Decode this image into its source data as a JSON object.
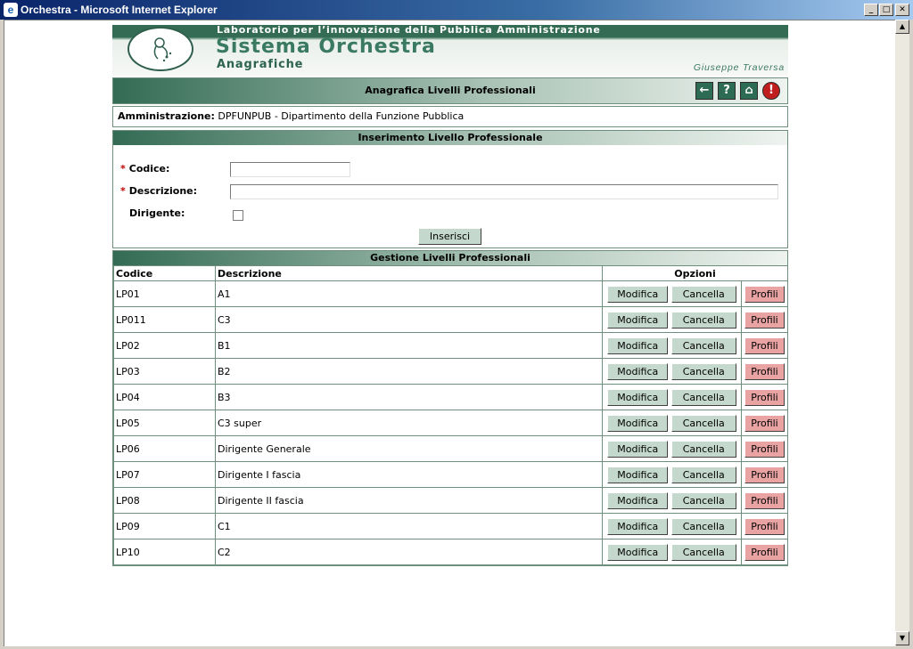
{
  "window": {
    "title": "Orchestra - Microsoft Internet Explorer"
  },
  "banner": {
    "lab": "Laboratorio per l’innovazione della Pubblica Amministrazione",
    "app_title": "Sistema Orchestra",
    "module": "Anagrafiche",
    "user": "Giuseppe Traversa"
  },
  "page_header": {
    "title": "Anagrafica Livelli Professionali"
  },
  "admin": {
    "label": "Amministrazione:",
    "value": "DPFUNPUB - Dipartimento della Funzione Pubblica"
  },
  "form": {
    "title": "Inserimento Livello Professionale",
    "codice_label": "Codice:",
    "codice_value": "",
    "descrizione_label": "Descrizione:",
    "descrizione_value": "",
    "dirigente_label": "Dirigente:",
    "dirigente_checked": false,
    "required_mark": "*",
    "submit_label": "Inserisci"
  },
  "grid": {
    "title": "Gestione Livelli Professionali",
    "columns": {
      "codice": "Codice",
      "descrizione": "Descrizione",
      "opzioni": "Opzioni"
    },
    "buttons": {
      "modifica": "Modifica",
      "cancella": "Cancella",
      "profili": "Profili"
    },
    "rows": [
      {
        "codice": "LP01",
        "descrizione": "A1"
      },
      {
        "codice": "LP011",
        "descrizione": "C3"
      },
      {
        "codice": "LP02",
        "descrizione": "B1"
      },
      {
        "codice": "LP03",
        "descrizione": "B2"
      },
      {
        "codice": "LP04",
        "descrizione": "B3"
      },
      {
        "codice": "LP05",
        "descrizione": "C3 super"
      },
      {
        "codice": "LP06",
        "descrizione": "Dirigente Generale"
      },
      {
        "codice": "LP07",
        "descrizione": "Dirigente I fascia"
      },
      {
        "codice": "LP08",
        "descrizione": "Dirigente II fascia"
      },
      {
        "codice": "LP09",
        "descrizione": "C1"
      },
      {
        "codice": "LP10",
        "descrizione": "C2"
      }
    ]
  },
  "toolbar_icons": [
    "back-arrow-icon",
    "help-icon",
    "home-icon",
    "logout-icon"
  ],
  "colors": {
    "brand_green": "#336b55",
    "button_green": "#c4d8cd",
    "button_red": "#e9a3a3",
    "title_blue": "#0a246a"
  }
}
